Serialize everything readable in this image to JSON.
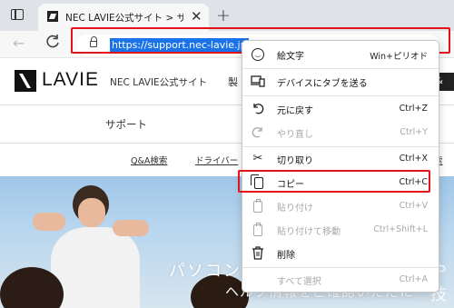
{
  "browser": {
    "tab_title": "NEC LAVIE公式サイト > サービス＆サ",
    "tab_close": "✕",
    "new_tab": "+",
    "back": "←",
    "reload": "C",
    "url": "https://support.nec-lavie.jp"
  },
  "site": {
    "logo": "LAVIE",
    "site_name": "NEC LAVIE公式サイト",
    "nav_partial": "製",
    "header_right": "& サ",
    "support_label": "サポート",
    "links": [
      "Q&A検索",
      "ドライバー",
      "索"
    ],
    "hero_line1": "パソコン",
    "hero_line2": "ヘルプ情報をご確認いただに",
    "hero_right1": "級",
    "hero_right2": "や技"
  },
  "context_menu": {
    "items": [
      {
        "icon": "emoji-icon",
        "label": "絵文字",
        "shortcut": "Win+ピリオド",
        "disabled": false
      },
      {
        "icon": "send-to-device-icon",
        "label": "デバイスにタブを送る",
        "shortcut": "",
        "disabled": false
      },
      {
        "icon": "undo-icon",
        "label": "元に戻す",
        "shortcut": "Ctrl+Z",
        "disabled": false
      },
      {
        "icon": "redo-icon",
        "label": "やり直し",
        "shortcut": "Ctrl+Y",
        "disabled": true
      },
      {
        "icon": "cut-icon",
        "label": "切り取り",
        "shortcut": "Ctrl+X",
        "disabled": false
      },
      {
        "icon": "copy-icon",
        "label": "コピー",
        "shortcut": "Ctrl+C",
        "disabled": false
      },
      {
        "icon": "paste-icon",
        "label": "貼り付け",
        "shortcut": "Ctrl+V",
        "disabled": true
      },
      {
        "icon": "paste-and-go-icon",
        "label": "貼り付けて移動",
        "shortcut": "Ctrl+Shift+L",
        "disabled": true
      },
      {
        "icon": "delete-icon",
        "label": "削除",
        "shortcut": "",
        "disabled": false
      },
      {
        "icon": "",
        "label": "すべて選択",
        "shortcut": "Ctrl+A",
        "disabled": true
      }
    ]
  },
  "colors": {
    "highlight_box": "#e3131b",
    "url_selection": "#1a73e8"
  }
}
